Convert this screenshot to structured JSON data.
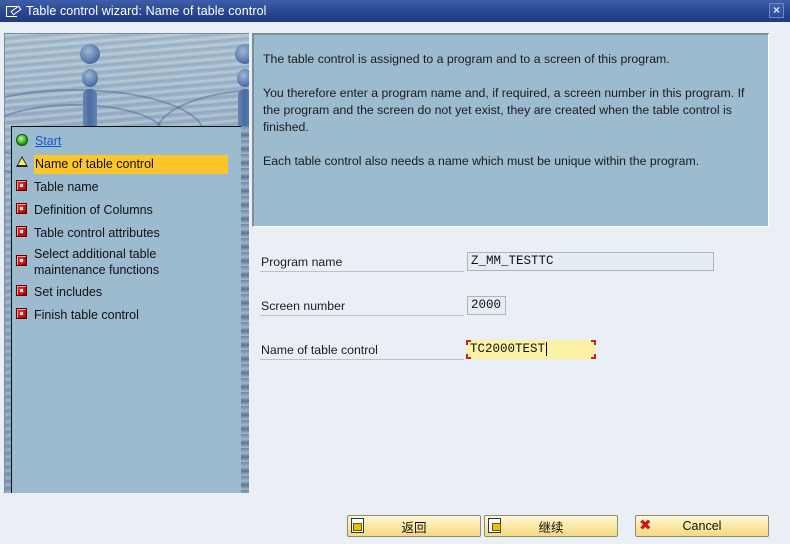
{
  "window": {
    "title": "Table control wizard: Name of table control",
    "close_label": "×"
  },
  "nav": {
    "items": [
      {
        "label": "Start",
        "status": "done",
        "icon": "green-light-icon"
      },
      {
        "label": "Name of table control",
        "status": "current",
        "icon": "yellow-triangle-icon"
      },
      {
        "label": "Table name",
        "status": "pending",
        "icon": "red-square-icon"
      },
      {
        "label": "Definition of Columns",
        "status": "pending",
        "icon": "red-square-icon"
      },
      {
        "label": "Table control attributes",
        "status": "pending",
        "icon": "red-square-icon"
      },
      {
        "label": "Select additional table maintenance functions",
        "status": "pending",
        "icon": "red-square-icon"
      },
      {
        "label": "Set includes",
        "status": "pending",
        "icon": "red-square-icon"
      },
      {
        "label": "Finish table control",
        "status": "pending",
        "icon": "red-square-icon"
      }
    ]
  },
  "info": {
    "paragraphs": [
      "The table control is assigned to a program and to a screen of this program.",
      "You therefore enter a program name and, if required, a screen number in this program. If the program and the screen do not yet exist, they are created when the table control is finished.",
      "Each table control also needs a name which must be unique within the program."
    ]
  },
  "form": {
    "program_name": {
      "label": "Program name",
      "value": "Z_MM_TESTTC"
    },
    "screen_number": {
      "label": "Screen number",
      "value": "2000"
    },
    "table_control_name": {
      "label": "Name of table control",
      "value": "TC2000TEST"
    }
  },
  "buttons": {
    "back": "返回",
    "continue": "继续",
    "cancel": "Cancel"
  },
  "colors": {
    "titlebar": "#2a4790",
    "active_step": "#fdc729",
    "panel": "#9dbbcf",
    "button": "#fbe9a6",
    "active_input": "#fcf2a6"
  }
}
